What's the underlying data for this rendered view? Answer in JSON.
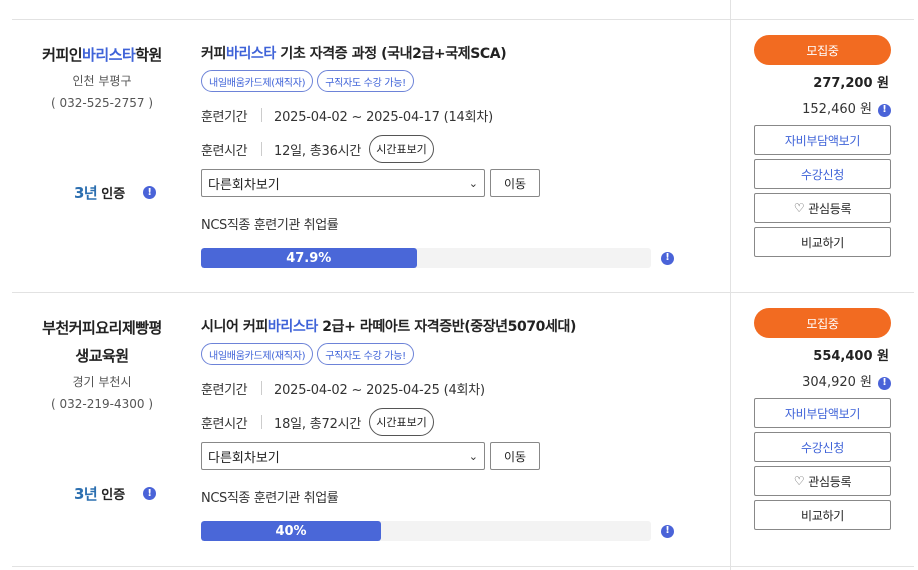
{
  "colors": {
    "accent": "#3f63d8",
    "status": "#f26b21",
    "bar_fill": "#4a67d8"
  },
  "icons": {
    "info": "info-circle-icon",
    "heart": "heart-icon",
    "chevron": "chevron-down-icon",
    "cert": "3-year-cert-icon"
  },
  "cards": [
    {
      "institution": {
        "name_pre": "커피인",
        "name_hl": "바리스타",
        "name_post": "학원",
        "name_line2": "",
        "region": "인천 부평구",
        "phone": "( 032-525-2757 )"
      },
      "cert": {
        "years": "3년",
        "label": "인증"
      },
      "course": {
        "title_pre": "커피",
        "title_hl": "바리스타",
        "title_post": " 기초 자격증 과정 (국내2급+국제SCA)"
      },
      "tags": [
        "내일배움카드제(재직자)",
        "구직자도 수강 가능!"
      ],
      "period_label": "훈련기간",
      "period_value": "2025-04-02 ~ 2025-04-17 (14회차)",
      "time_label": "훈련시간",
      "time_value": "12일, 총36시간",
      "schedule_btn": "시간표보기",
      "select_value": "다른회차보기",
      "move_btn": "이동",
      "ncs_label": "NCS직종 훈련기관 취업률",
      "employment_rate": 0.479,
      "employment_text": "47.9%",
      "status": "모집중",
      "price": "277,200 원",
      "sub_price": "152,460 원",
      "btn_selfpay": "자비부담액보기",
      "btn_apply": "수강신청",
      "btn_wish": "관심등록",
      "btn_compare": "비교하기"
    },
    {
      "institution": {
        "name_pre": "부천커피요리제빵평",
        "name_hl": "",
        "name_post": "",
        "name_line2": "생교육원",
        "region": "경기 부천시",
        "phone": "( 032-219-4300 )"
      },
      "cert": {
        "years": "3년",
        "label": "인증"
      },
      "course": {
        "title_pre": "시니어 커피",
        "title_hl": "바리스타",
        "title_post": " 2급+ 라떼아트 자격증반(중장년5070세대)"
      },
      "tags": [
        "내일배움카드제(재직자)",
        "구직자도 수강 가능!"
      ],
      "period_label": "훈련기간",
      "period_value": "2025-04-02 ~ 2025-04-25 (4회차)",
      "time_label": "훈련시간",
      "time_value": "18일, 총72시간",
      "schedule_btn": "시간표보기",
      "select_value": "다른회차보기",
      "move_btn": "이동",
      "ncs_label": "NCS직종 훈련기관 취업률",
      "employment_rate": 0.4,
      "employment_text": "40%",
      "status": "모집중",
      "price": "554,400 원",
      "sub_price": "304,920 원",
      "btn_selfpay": "자비부담액보기",
      "btn_apply": "수강신청",
      "btn_wish": "관심등록",
      "btn_compare": "비교하기"
    }
  ]
}
